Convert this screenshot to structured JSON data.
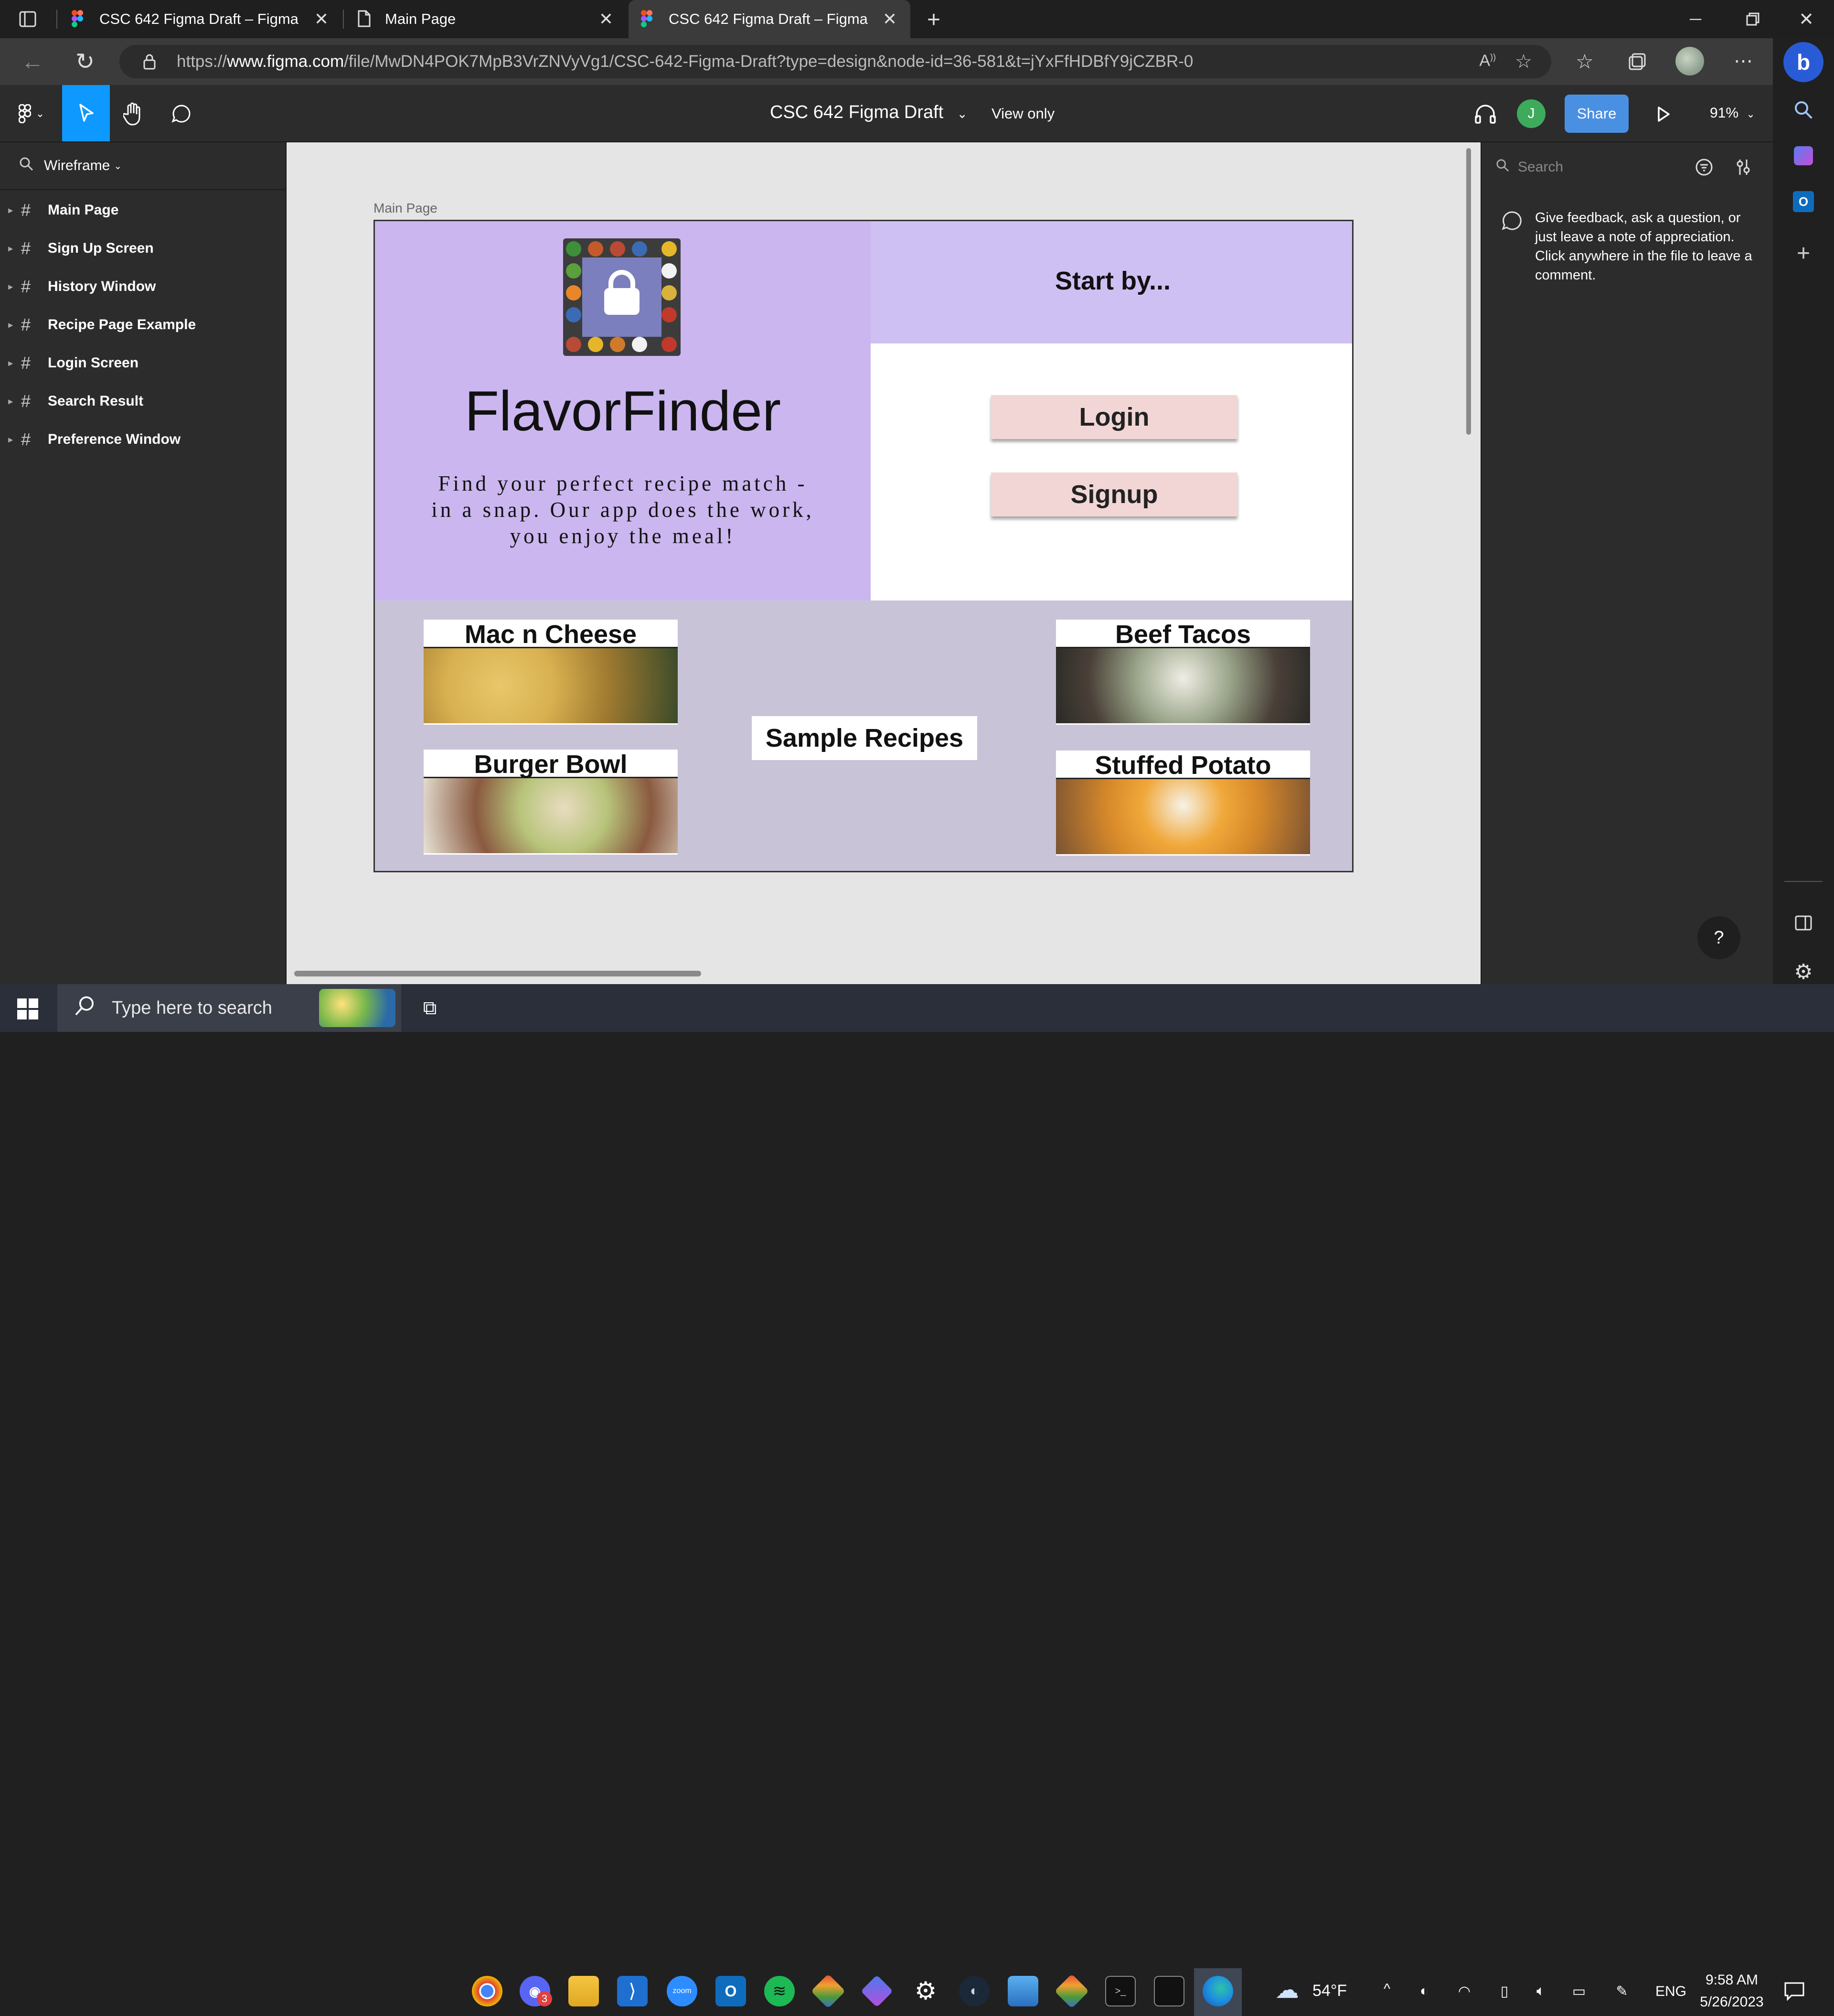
{
  "browser": {
    "tabs": [
      {
        "label": "CSC 642 Figma Draft – Figma"
      },
      {
        "label": "Main Page"
      },
      {
        "label": "CSC 642 Figma Draft – Figma"
      }
    ],
    "url_prefix": "https://",
    "url_host": "www.figma.com",
    "url_path": "/file/MwDN4POK7MpB3VrZNVyVg1/CSC-642-Figma-Draft?type=design&node-id=36-581&t=jYxFfHDBfY9jCZBR-0"
  },
  "figma": {
    "file_title": "CSC 642 Figma Draft",
    "view_mode": "View only",
    "avatar_initial": "J",
    "share_label": "Share",
    "zoom": "91%",
    "page_selector": "Wireframe",
    "layers": [
      {
        "label": "Main Page"
      },
      {
        "label": "Sign Up Screen"
      },
      {
        "label": "History Window"
      },
      {
        "label": "Recipe Page Example"
      },
      {
        "label": "Login Screen"
      },
      {
        "label": "Search Result"
      },
      {
        "label": "Preference Window"
      }
    ],
    "right_panel": {
      "search_placeholder": "Search",
      "comment_hint": "Give feedback, ask a question, or just leave a note of appreciation. Click anywhere in the file to leave a comment."
    },
    "help": "?"
  },
  "frame": {
    "label": "Main Page",
    "app_name": "FlavorFinder",
    "tagline": "Find your perfect recipe match - in a snap. Our app does the work, you enjoy the meal!",
    "start_by": "Start by...",
    "login_label": "Login",
    "signup_label": "Signup",
    "sample_label": "Sample Recipes",
    "recipes": [
      {
        "name": "Mac n Cheese"
      },
      {
        "name": "Beef Tacos"
      },
      {
        "name": "Burger Bowl"
      },
      {
        "name": "Stuffed Potato"
      }
    ]
  },
  "taskbar": {
    "search_placeholder": "Type here to search",
    "weather": "54°F",
    "language": "ENG",
    "time": "9:58 AM",
    "date": "5/26/2023",
    "discord_badge": "3"
  },
  "colors": {
    "frame_lavender": "#cbb6ef",
    "button_pink": "#f2d6d6",
    "figma_blue": "#4a90e2",
    "avatar_green": "#3daa5c"
  }
}
